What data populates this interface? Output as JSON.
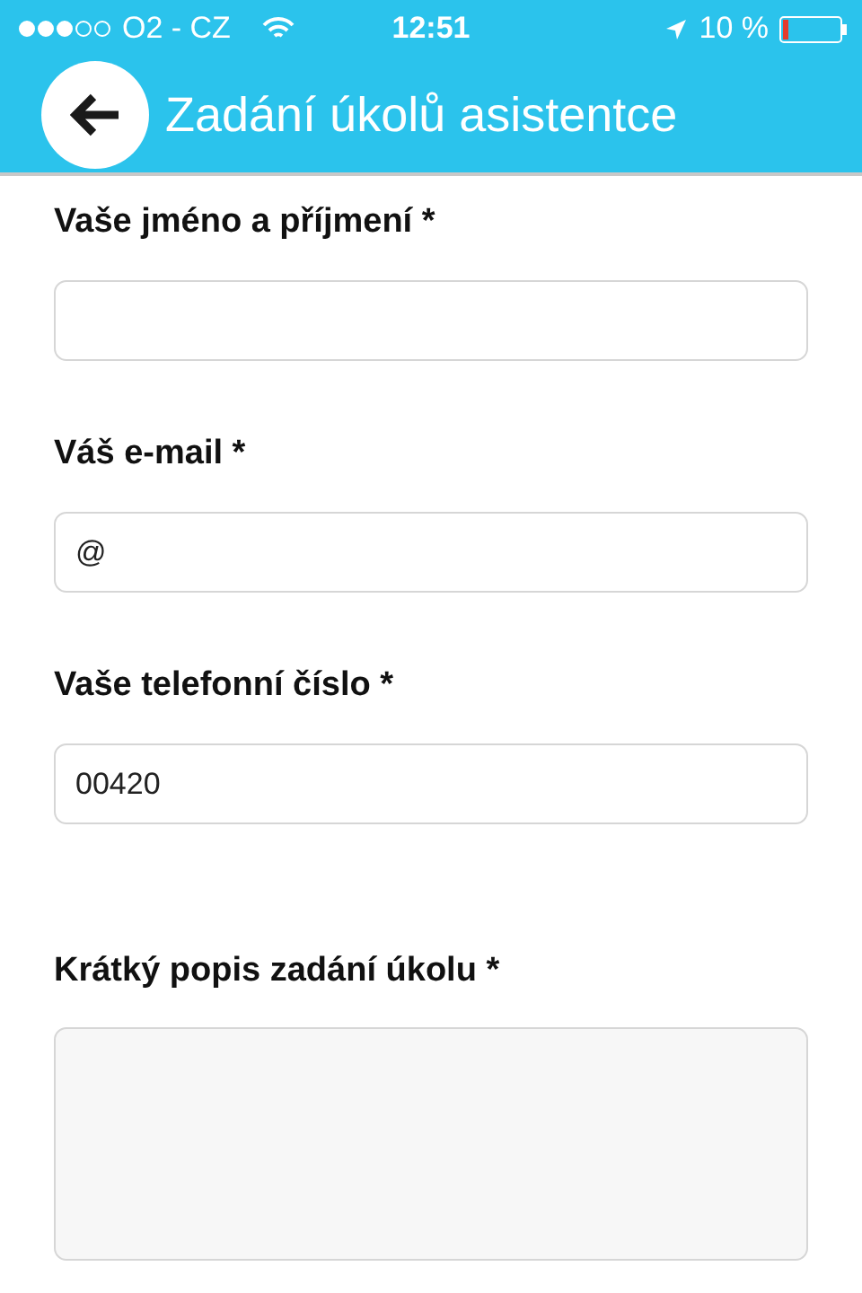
{
  "status_bar": {
    "carrier": "O2 - CZ",
    "time": "12:51",
    "battery": "10 %"
  },
  "header": {
    "title": "Zadání úkolů asistentce"
  },
  "fields": [
    {
      "kind": "input",
      "label": "Vaše jméno a příjmení *"
    },
    {
      "kind": "input",
      "label": "Váš e-mail *",
      "value": "@"
    },
    {
      "kind": "input",
      "label": "Vaše telefonní číslo *",
      "value": "00420"
    },
    {
      "kind": "textarea",
      "label": "Krátký popis zadání úkolu *"
    }
  ]
}
